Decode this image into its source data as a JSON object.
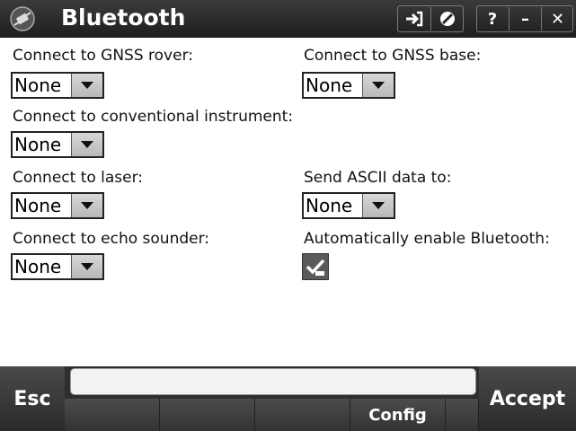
{
  "window": {
    "title": "Bluetooth",
    "app_icon": "satellite-icon",
    "buttons": {
      "sign_in_icon": "sign-in-icon",
      "no_entry_icon": "no-entry-icon",
      "help_label": "?",
      "minimize_label": "–",
      "close_label": "✕"
    }
  },
  "form": {
    "gnss_rover": {
      "label": "Connect to GNSS rover:",
      "value": "None"
    },
    "gnss_base": {
      "label": "Connect to GNSS base:",
      "value": "None"
    },
    "conventional": {
      "label": "Connect to conventional instrument:",
      "value": "None"
    },
    "laser": {
      "label": "Connect to laser:",
      "value": "None"
    },
    "ascii": {
      "label": "Send ASCII data to:",
      "value": "None"
    },
    "echo": {
      "label": "Connect to echo sounder:",
      "value": "None"
    },
    "auto_enable": {
      "label": "Automatically enable Bluetooth:",
      "checked": true
    }
  },
  "bottom": {
    "esc_label": "Esc",
    "accept_label": "Accept",
    "config_label": "Config"
  },
  "colors": {
    "titlebar": "#2a2a2a",
    "bottombar": "#2e2e2e",
    "checkbox": "#5a5a5a"
  }
}
